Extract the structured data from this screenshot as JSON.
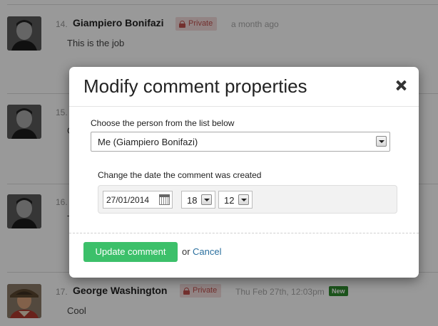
{
  "comments": [
    {
      "number": "14.",
      "author": "Giampiero Bonifazi",
      "private_label": "Private",
      "time": "a month ago",
      "body": "This is the job"
    },
    {
      "number": "15.",
      "body_fragment": "G"
    },
    {
      "number": "16.",
      "body_fragment": "T"
    },
    {
      "number": "17.",
      "author": "George Washington",
      "private_label": "Private",
      "time": "Thu Feb 27th, 12:03pm",
      "new_label": "New",
      "body": "Cool"
    }
  ],
  "modal": {
    "title": "Modify comment properties",
    "person_label": "Choose the person from the list below",
    "person_value": "Me (Giampiero Bonifazi)",
    "date_label": "Change the date the comment was created",
    "date_value": "27/01/2014",
    "hour_value": "18",
    "minute_value": "12",
    "update_button": "Update comment",
    "or_text": "or",
    "cancel_link": "Cancel"
  },
  "colors": {
    "update_button": "#3cc06a",
    "private_badge_bg": "#f3dcdc",
    "private_badge_text": "#c0504d",
    "new_badge": "#2e8b2e",
    "cancel_link": "#2a6f9e"
  }
}
